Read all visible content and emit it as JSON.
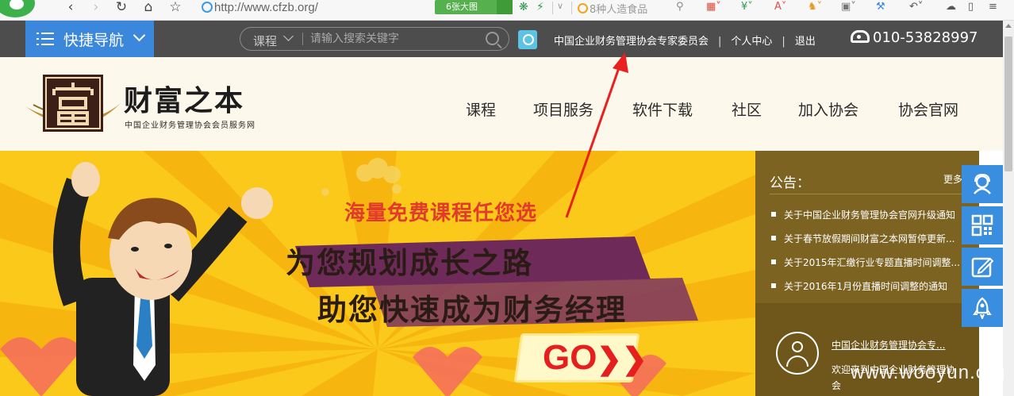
{
  "browser": {
    "url": "http://www.cfzb.org/",
    "pic_button_label": "6张大图",
    "search_suggestion": "8种人造食品"
  },
  "topbar": {
    "quick_nav_label": "快捷导航",
    "search": {
      "category": "课程",
      "placeholder": "请输入搜索关键字"
    },
    "links": [
      "中国企业财务管理协会专家委员会",
      "个人中心",
      "退出"
    ],
    "phone": "010-53828997"
  },
  "brand": {
    "title": "财富之本",
    "subtitle": "中国企业财务管理协会会员服务网"
  },
  "main_nav": [
    "课程",
    "项目服务",
    "软件下载",
    "社区",
    "加入协会",
    "协会官网"
  ],
  "banner": {
    "headline1": "海量免费课程任您选",
    "headline2": "为您规划成长之路",
    "headline3": "助您快速成为财务经理",
    "go_label": "GO"
  },
  "notice": {
    "title": "公告：",
    "more": "更多",
    "items": [
      "关于中国企业财务管理协会官网升级通知",
      "关于春节放假期间财富之本网暂停更新...",
      "关于2015年汇缴行业专题直播时间调整...",
      "关于2016年1月份直播时间调整的通知"
    ],
    "org_link": "中国企业财务管理协会专...",
    "welcome": "欢迎来到中国企业财务管理协会"
  },
  "float_bar_icons": [
    "customer-service-icon",
    "qr-code-icon",
    "edit-icon",
    "rocket-icon"
  ],
  "watermark": "www.wooyun.org",
  "colors": {
    "topbar": "#4d4d4d",
    "quick_nav": "#3a87dc",
    "header_bg": "#fdf8ec",
    "banner_bg": "#fbc91a",
    "notice_bg": "#7d6322",
    "accent_red": "#e23a2b",
    "float_bar": "#3a8ee0"
  }
}
